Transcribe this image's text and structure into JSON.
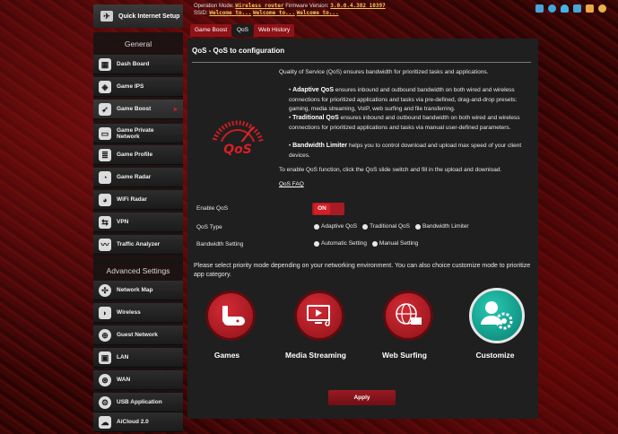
{
  "topbar": {
    "op_mode_label": "Operation Mode:",
    "op_mode_value": "Wireless router",
    "fw_label": "Firmware Version:",
    "fw_value": "3.0.0.4.382_10397",
    "ssid_label": "SSID:",
    "ssid_values": [
      "Welcome to...",
      "Welcome to...",
      "Welcome to..."
    ],
    "icons": [
      "usb-icon",
      "gear-network-icon",
      "user-icon",
      "dongle-icon",
      "bell-icon",
      "settings-icon"
    ]
  },
  "sidebar": {
    "quick_setup": "Quick Internet Setup",
    "general_heading": "General",
    "advanced_heading": "Advanced Settings",
    "general_items": [
      {
        "label": "Dash Board",
        "icon": "dashboard-icon"
      },
      {
        "label": "Game IPS",
        "icon": "shield-icon"
      },
      {
        "label": "Game Boost",
        "icon": "rocket-icon"
      },
      {
        "label": "Game Private Network",
        "icon": "private-network-icon"
      },
      {
        "label": "Game Profile",
        "icon": "profile-icon"
      },
      {
        "label": "Game Radar",
        "icon": "radar-icon"
      },
      {
        "label": "WiFi Radar",
        "icon": "wifi-radar-icon"
      },
      {
        "label": "VPN",
        "icon": "vpn-icon"
      },
      {
        "label": "Traffic Analyzer",
        "icon": "traffic-icon"
      }
    ],
    "advanced_items": [
      {
        "label": "Network Map",
        "icon": "network-map-icon"
      },
      {
        "label": "Wireless",
        "icon": "wireless-icon"
      },
      {
        "label": "Guest Network",
        "icon": "guest-network-icon"
      },
      {
        "label": "LAN",
        "icon": "lan-icon"
      },
      {
        "label": "WAN",
        "icon": "wan-icon"
      },
      {
        "label": "USB Application",
        "icon": "usb-app-icon"
      },
      {
        "label": "AiCloud 2.0",
        "icon": "cloud-icon"
      }
    ]
  },
  "tabs": [
    "Game Boost",
    "QoS",
    "Web History"
  ],
  "main": {
    "title": "QoS - QoS to configuration",
    "intro": "Quality of Service (QoS) ensures bandwidth for prioritized tasks and applications.",
    "bullets": [
      {
        "title": "Adaptive QoS",
        "text": " ensures inbound and outbound bandwidth on both wired and wireless connections for prioritized applications and tasks via pre-defined, drag-and-drop presets: gaming, media streaming, VoIP, web surfing and file transferring."
      },
      {
        "title": "Traditional QoS",
        "text": " ensures inbound and outbound bandwidth on both wired and wireless connections for prioritized applications and tasks via manual user-defined parameters."
      },
      {
        "title": "Bandwidth Limiter",
        "text": " helps you to control download and upload max speed of your client devices."
      }
    ],
    "enable_note": "To enable QoS function, click the QoS slide switch and fill in the upload and download.",
    "faq_link": "QoS FAQ",
    "logo_text": "QoS"
  },
  "form": {
    "enable_label": "Enable QoS",
    "enable_state": "ON",
    "type_label": "QoS Type",
    "type_options": [
      "Adaptive QoS",
      "Traditional QoS",
      "Bandwidth Limiter"
    ],
    "bw_label": "Bandwidth Setting",
    "bw_options": [
      "Automatic Setting",
      "Manual Setting"
    ]
  },
  "priority_note": "Please select priority mode depending on your networking environment. You can also choice customize mode to prioritize app category.",
  "categories": [
    {
      "label": "Games",
      "icon": "gamepad-icon",
      "color": "#b51d28"
    },
    {
      "label": "Media Streaming",
      "icon": "media-icon",
      "color": "#b51d28"
    },
    {
      "label": "Web Surfing",
      "icon": "globe-icon",
      "color": "#b51d28"
    },
    {
      "label": "Customize",
      "icon": "customize-icon",
      "color": "#0fa896"
    }
  ],
  "apply_label": "Apply",
  "colors": {
    "accent": "#8e1318",
    "panel": "#1f1f1f",
    "customize": "#0fa896"
  }
}
